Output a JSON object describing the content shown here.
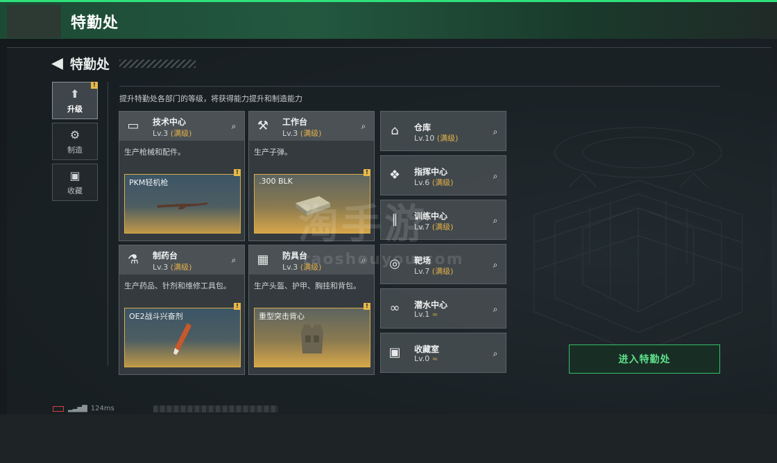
{
  "topbar": {
    "title": "特勤处"
  },
  "header": {
    "back_label": "特勤处",
    "subtitle": "提升特勤处各部门的等级，将获得能力提升和制造能力"
  },
  "tabs": [
    {
      "label": "升级",
      "icon": "upgrade-icon",
      "active": true,
      "badge": "!"
    },
    {
      "label": "制造",
      "icon": "gears-icon",
      "active": false
    },
    {
      "label": "收藏",
      "icon": "collection-icon",
      "active": false
    }
  ],
  "departments": [
    {
      "name": "技术中心",
      "level": "Lv.3",
      "status": "(满级)",
      "desc": "生产枪械和配件。",
      "item": "PKM轻机枪",
      "icon": "monitor-icon",
      "item_badge": "!"
    },
    {
      "name": "工作台",
      "level": "Lv.3",
      "status": "(满级)",
      "desc": "生产子弹。",
      "item": ".300 BLK",
      "icon": "tools-icon",
      "item_badge": "!"
    },
    {
      "name": "制药台",
      "level": "Lv.3",
      "status": "(满级)",
      "desc": "生产药品、针剂和维修工具包。",
      "item": "OE2战斗兴奋剂",
      "icon": "microscope-icon",
      "item_badge": "!"
    },
    {
      "name": "防具台",
      "level": "Lv.3",
      "status": "(满级)",
      "desc": "生产头盔、护甲、胸挂和背包。",
      "item": "重型突击背心",
      "icon": "armor-icon",
      "item_badge": "!"
    }
  ],
  "facilities": [
    {
      "name": "仓库",
      "level": "Lv.10",
      "status": "(满级)",
      "icon": "warehouse-icon"
    },
    {
      "name": "指挥中心",
      "level": "Lv.6",
      "status": "(满级)",
      "icon": "command-icon"
    },
    {
      "name": "训练中心",
      "level": "Lv.7",
      "status": "(满级)",
      "icon": "dumbbell-icon"
    },
    {
      "name": "靶场",
      "level": "Lv.7",
      "status": "(满级)",
      "icon": "target-icon"
    },
    {
      "name": "潜水中心",
      "level": "Lv.1",
      "status": "≈",
      "icon": "diving-icon"
    },
    {
      "name": "收藏室",
      "level": "Lv.0",
      "status": "≈",
      "icon": "vault-icon"
    }
  ],
  "enter_button": "进入特勤处",
  "status": {
    "ping": "124ms"
  },
  "watermark": {
    "cn": "淘手游",
    "en": "taoshouyou.com"
  },
  "colors": {
    "accent_green": "#35c06a",
    "max_gold": "#e3b14a"
  }
}
